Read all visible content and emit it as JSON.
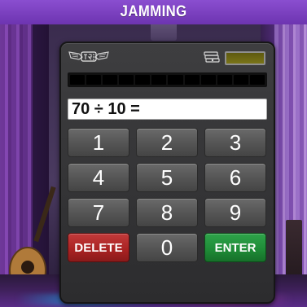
{
  "header": {
    "title": "JAMMING"
  },
  "device": {
    "logo_icon": "winged-shield-logo-icon",
    "cash_icon": "cash-stack-icon",
    "progress_segments": 12
  },
  "display": {
    "expression": "70 ÷ 10 ="
  },
  "keypad": {
    "keys": [
      {
        "label": "1",
        "type": "num"
      },
      {
        "label": "2",
        "type": "num"
      },
      {
        "label": "3",
        "type": "num"
      },
      {
        "label": "4",
        "type": "num"
      },
      {
        "label": "5",
        "type": "num"
      },
      {
        "label": "6",
        "type": "num"
      },
      {
        "label": "7",
        "type": "num"
      },
      {
        "label": "8",
        "type": "num"
      },
      {
        "label": "9",
        "type": "num"
      },
      {
        "label": "DELETE",
        "type": "del"
      },
      {
        "label": "0",
        "type": "num"
      },
      {
        "label": "ENTER",
        "type": "ent"
      }
    ]
  },
  "colors": {
    "title_bar": "#7a3fc0",
    "delete": "#b02a2a",
    "enter": "#1e8a36",
    "lcd": "#6e6a14"
  }
}
